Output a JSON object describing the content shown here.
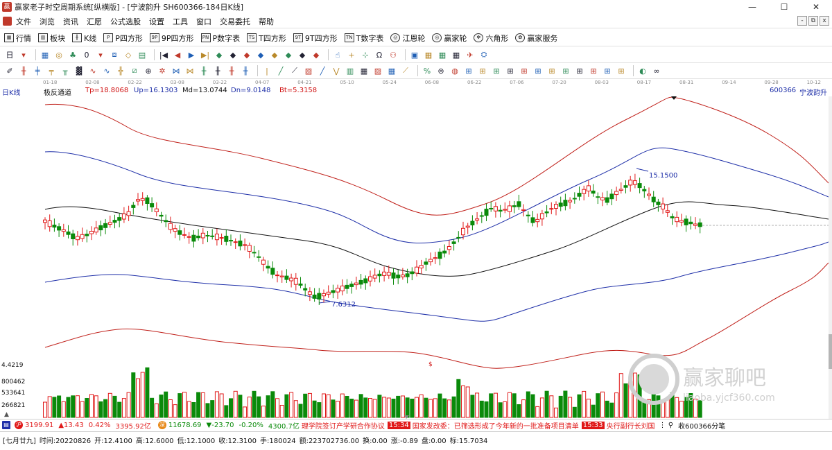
{
  "window": {
    "title": "赢家老子时空周期系统[纵横版] - [宁波韵升  SH600366-184日K线]",
    "controls": [
      "—",
      "☐",
      "✕"
    ]
  },
  "menu": {
    "items": [
      "文件",
      "浏览",
      "资讯",
      "汇愿",
      "公式选股",
      "设置",
      "工具",
      "窗口",
      "交易委托",
      "帮助"
    ],
    "mdi": [
      "-",
      "⧉",
      "x"
    ]
  },
  "toolbar1": {
    "items": [
      {
        "label": "行情",
        "icon": "grid-icon",
        "glyph": "▦"
      },
      {
        "label": "板块",
        "icon": "blocks-icon",
        "glyph": "▥"
      },
      {
        "label": "K线",
        "icon": "kline-icon",
        "glyph": "╫"
      },
      {
        "label": "P四方形",
        "icon": "p-square-icon",
        "glyph": "P"
      },
      {
        "label": "9P四方形",
        "icon": "9p-square-icon",
        "glyph": "9P"
      },
      {
        "label": "P数字表",
        "icon": "p-number-icon",
        "glyph": "PN"
      },
      {
        "label": "T四方形",
        "icon": "t-square-icon",
        "glyph": "TS"
      },
      {
        "label": "9T四方形",
        "icon": "9t-square-icon",
        "glyph": "9T"
      },
      {
        "label": "T数字表",
        "icon": "t-number-icon",
        "glyph": "TN"
      },
      {
        "label": "江恩轮",
        "icon": "gann-wheel-icon",
        "glyph": "◎"
      },
      {
        "label": "赢家轮",
        "icon": "winner-wheel-icon",
        "glyph": "◎"
      },
      {
        "label": "六角形",
        "icon": "hexagon-icon",
        "glyph": "✻"
      },
      {
        "label": "赢家服务",
        "icon": "service-icon",
        "glyph": "✿"
      }
    ]
  },
  "toolbar2": {
    "glyphs": [
      "日",
      "▾",
      "▦",
      "◎",
      "♣",
      "0",
      "▾",
      "⧈",
      "◇",
      "▤",
      "|◀",
      "◀",
      "▶",
      "▶|",
      "◆",
      "◆",
      "◆",
      "◆",
      "◆",
      "◆",
      "◆",
      "◆",
      "☝",
      "+",
      "⊹",
      "Ω",
      "⚇",
      "▣",
      "▦",
      "▦",
      "▦",
      "✈",
      "⛭"
    ]
  },
  "toolbar3": {
    "glyphs": [
      "✐",
      "╫",
      "╪",
      "╤",
      "╥",
      "▓",
      "∿",
      "∿",
      "╬",
      "⧄",
      "⊕",
      "✲",
      "⋈",
      "⋈",
      "╫",
      "╫",
      "╫",
      "╫",
      "|",
      "╱",
      "⟋",
      "▨",
      "╱",
      "⋁",
      "▥",
      "▦",
      "▨",
      "▦",
      "⟋",
      "%",
      "⊜",
      "◍",
      "⊞",
      "⊞",
      "⊞",
      "⊞",
      "⊞",
      "⊞",
      "⊞",
      "⊞",
      "⊞",
      "⊞",
      "⊞",
      "⊞",
      "◐",
      "∞"
    ]
  },
  "date_axis": [
    "01-18",
    "02-08",
    "02-22",
    "03-08",
    "03-22",
    "04-07",
    "04-21",
    "05-10",
    "05-24",
    "06-08",
    "06-22",
    "07-06",
    "07-20",
    "08-03",
    "08-17",
    "08-31",
    "09-14",
    "09-28",
    "10-12"
  ],
  "chart_header": {
    "period": "日K线",
    "indicator": "极反通道",
    "tp": "Tp=18.8068",
    "up": "Up=16.1303",
    "md": "Md=13.0744",
    "dn": "Dn=9.0148",
    "bt": "Bt=5.3158",
    "stock_code": "600366",
    "stock_name": "宁波韵升"
  },
  "chart_data": {
    "type": "candlestick",
    "high_label": "15.1500",
    "low_label": "7.6312",
    "dollar_mark": "$",
    "volume_ticks": [
      "4.4219",
      "800462",
      "533641",
      "266821"
    ],
    "colors": {
      "up": "#e01818",
      "down": "#0a8a0a",
      "outer_band": "#c0201a",
      "inner_band": "#1e2fa8",
      "mid": "#111111"
    }
  },
  "status_bar": {
    "sh_index": "3199.91",
    "sh_change": "▲13.43",
    "sh_pct": "0.42%",
    "sh_amount": "3395.92亿",
    "sz_index": "11678.69",
    "sz_change": "▼-23.70",
    "sz_pct": "-0.20%",
    "sz_amount": "4300.7亿",
    "news1": "理学院签订产学研合作协议",
    "time1": "15:34",
    "news2": "国家发改委：已筛选形成了今年新的一批准备项目清单",
    "time2": "15:33",
    "news3": "央行副行长刘国",
    "search": "收600366分笔"
  },
  "quote_bar": {
    "lunar": "[七月廿九]",
    "time": "时间:20220826",
    "open": "开:12.4100",
    "high": "高:12.6000",
    "low": "低:12.1000",
    "close": "收:12.3100",
    "hand": "手:180024",
    "amount": "额:223702736.00",
    "turnover": "换:0.00",
    "change": "涨:-0.89",
    "pan": "盘:0.00",
    "mark": "标:15.7034"
  },
  "watermark": {
    "text": "赢家聊吧",
    "url": "liaoba.yjcf360.com"
  }
}
